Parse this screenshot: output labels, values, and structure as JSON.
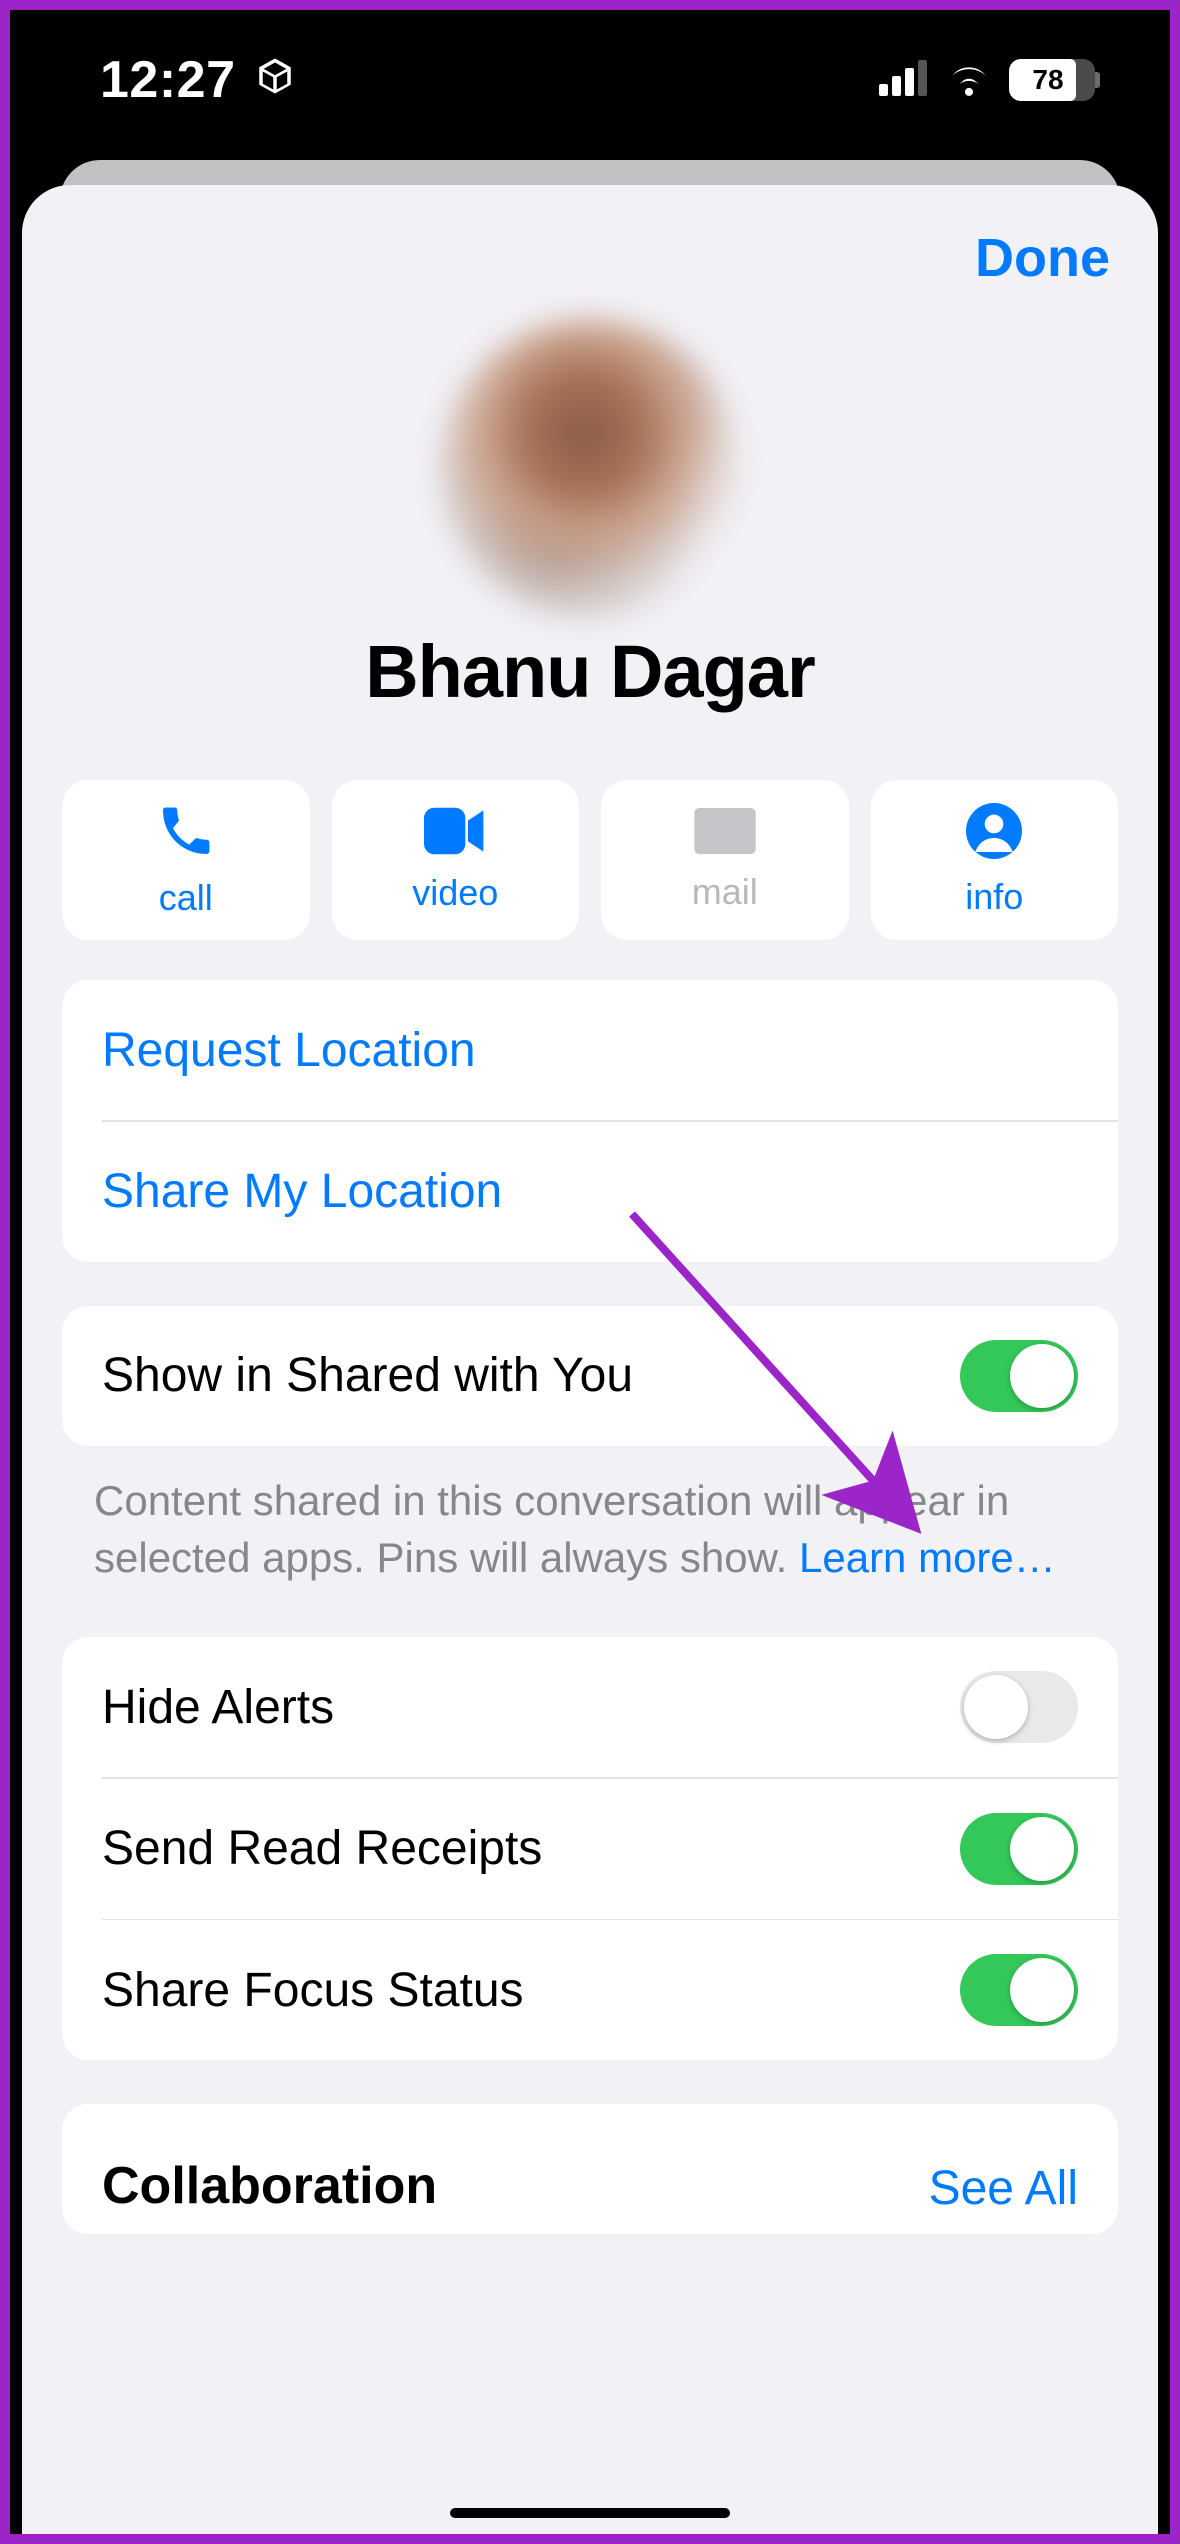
{
  "status": {
    "time": "12:27",
    "battery_text": "78"
  },
  "nav": {
    "done": "Done"
  },
  "contact": {
    "name": "Bhanu Dagar"
  },
  "actions": {
    "call": {
      "label": "call",
      "enabled": true
    },
    "video": {
      "label": "video",
      "enabled": true
    },
    "mail": {
      "label": "mail",
      "enabled": false
    },
    "info": {
      "label": "info",
      "enabled": true
    }
  },
  "location": {
    "request": "Request Location",
    "share": "Share My Location"
  },
  "shared": {
    "label": "Show in Shared with You",
    "on": true,
    "footnote_a": "Content shared in this conversation will appear in selected apps. Pins will always show. ",
    "footnote_link": "Learn more…"
  },
  "settings": {
    "hide_alerts": {
      "label": "Hide Alerts",
      "on": false
    },
    "read_receipts": {
      "label": "Send Read Receipts",
      "on": true
    },
    "focus_status": {
      "label": "Share Focus Status",
      "on": true
    }
  },
  "collab": {
    "title": "Collaboration",
    "see_all": "See All"
  }
}
